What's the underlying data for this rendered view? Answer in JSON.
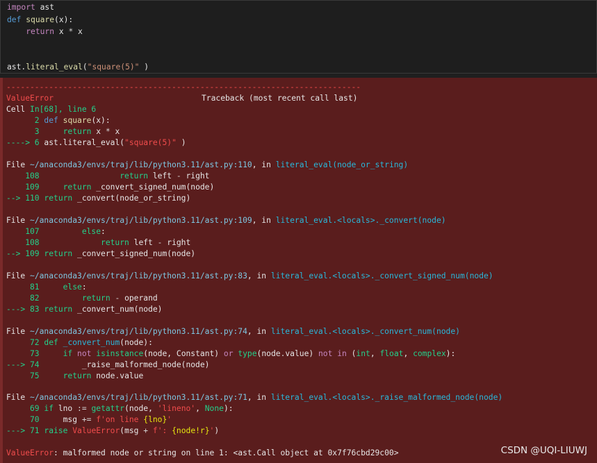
{
  "code": {
    "l1": [
      "import",
      " ast"
    ],
    "l2": [
      "def",
      " ",
      "square",
      "(x):"
    ],
    "l3": [
      "    ",
      "return",
      " x ",
      "*",
      " x"
    ],
    "l5": [
      "ast",
      ".",
      "literal_eval",
      "(",
      "\"square(5)\"",
      " )"
    ]
  },
  "tb": {
    "dashes": "---------------------------------------------------------------------------",
    "err_name": "ValueError",
    "tb_header": "Traceback (most recent call last)",
    "cell_prefix": "Cell ",
    "cell_in": "In[68], line 6",
    "c2": [
      "      2 ",
      "def ",
      "square",
      "(x):"
    ],
    "c3": [
      "      3     ",
      "return",
      " x ",
      "*",
      " x"
    ],
    "c6": [
      "----> 6 ",
      "ast",
      ".",
      "literal_eval(",
      "\"square(5)\"",
      " )"
    ],
    "f1": [
      "File ",
      "~/anaconda3/envs/traj/lib/python3.11/ast.py:110",
      ", in ",
      "literal_eval",
      "(node_or_string)"
    ],
    "f1a": [
      "    108",
      "                 ",
      "return",
      " left ",
      "-",
      " right"
    ],
    "f1b": [
      "    109",
      "     ",
      "return",
      " _convert_signed_num(node)"
    ],
    "f1c": [
      "--> 110",
      " ",
      "return",
      " _convert(node_or_string)"
    ],
    "f2": [
      "File ",
      "~/anaconda3/envs/traj/lib/python3.11/ast.py:109",
      ", in ",
      "literal_eval.<locals>._convert",
      "(node)"
    ],
    "f2a": [
      "    107",
      "         ",
      "else",
      ":"
    ],
    "f2b": [
      "    108",
      "             ",
      "return",
      " left ",
      "-",
      " right"
    ],
    "f2c": [
      "--> 109",
      " ",
      "return",
      " _convert_signed_num(node)"
    ],
    "f3": [
      "File ",
      "~/anaconda3/envs/traj/lib/python3.11/ast.py:83",
      ", in ",
      "literal_eval.<locals>._convert_signed_num",
      "(node)"
    ],
    "f3a": [
      "     81",
      "     ",
      "else",
      ":"
    ],
    "f3b": [
      "     82",
      "         ",
      "return",
      " ",
      "-",
      " operand"
    ],
    "f3c": [
      "---> 83",
      " ",
      "return",
      " _convert_num(node)"
    ],
    "f4": [
      "File ",
      "~/anaconda3/envs/traj/lib/python3.11/ast.py:74",
      ", in ",
      "literal_eval.<locals>._convert_num",
      "(node)"
    ],
    "f4a": [
      "     72",
      " ",
      "def",
      " ",
      "_convert_num",
      "(node):"
    ],
    "f4b": [
      "     73",
      "     ",
      "if",
      " ",
      "not",
      " ",
      "isinstance",
      "(node, Constant) ",
      "or",
      " ",
      "type",
      "(node",
      ".",
      "value) ",
      "not",
      " ",
      "in",
      " (",
      "int",
      ", ",
      "float",
      ", ",
      "complex",
      "):"
    ],
    "f4c": [
      "---> 74",
      "         _raise_malformed_node(node)"
    ],
    "f4d": [
      "     75",
      "     ",
      "return",
      " node",
      ".",
      "value"
    ],
    "f5": [
      "File ",
      "~/anaconda3/envs/traj/lib/python3.11/ast.py:71",
      ", in ",
      "literal_eval.<locals>._raise_malformed_node",
      "(node)"
    ],
    "f5a": [
      "     69",
      " ",
      "if",
      " lno ",
      ":=",
      " ",
      "getattr",
      "(node, ",
      "'lineno'",
      ", ",
      "None",
      "):"
    ],
    "f5b": [
      "     70",
      "     msg ",
      "+=",
      " ",
      "f'",
      "on line ",
      "{lno}",
      "'"
    ],
    "f5c": [
      "---> 71",
      " ",
      "raise",
      " ",
      "ValueError",
      "(msg ",
      "+",
      " ",
      "f'",
      ": ",
      "{node!r}",
      "'",
      ")"
    ],
    "final_err": "ValueError",
    "final_msg": ": malformed node or string on line 1: <ast.Call object at 0x7f76cbd29c00>"
  },
  "watermark": "CSDN @UQI-LIUWJ"
}
